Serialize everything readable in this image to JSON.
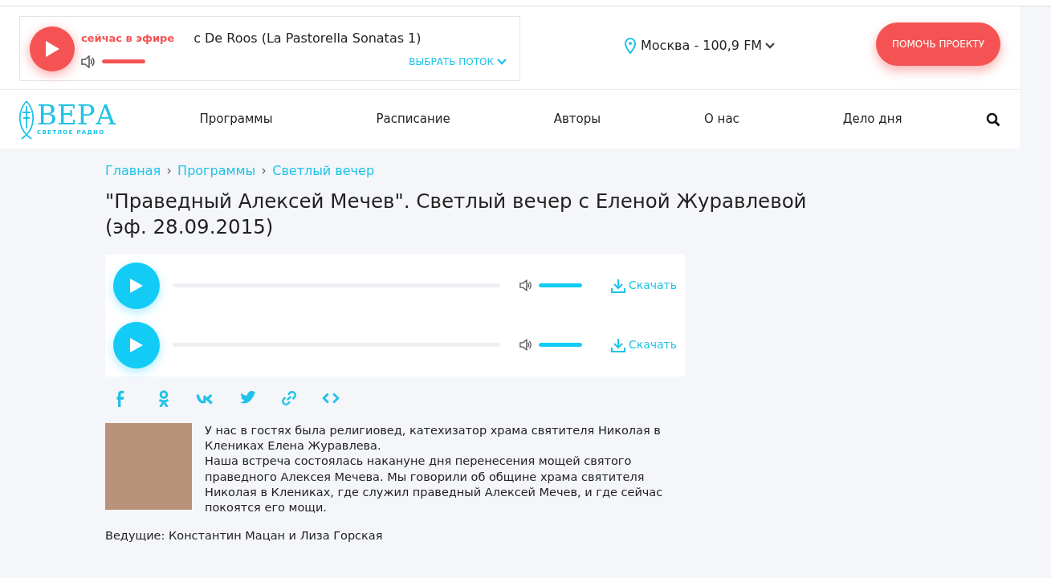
{
  "player": {
    "on_air": "сейчас в эфире",
    "track": "c De Roos (La Pastorella Sonatas 1)",
    "volume": {
      "level": 1
    },
    "stream_button": "ВЫБРАТЬ ПОТОК"
  },
  "station": "Москва - 100,9 FM",
  "donate_button": "ПОМОЧЬ ПРОЕКТУ",
  "logo": {
    "name": "ВЕРА",
    "tagline": "СВЕТЛОЕ РАДИО"
  },
  "nav": [
    "Программы",
    "Расписание",
    "Авторы",
    "О нас",
    "Дело дня"
  ],
  "breadcrumbs": [
    "Главная",
    "Программы",
    "Светлый вечер"
  ],
  "title": "\"Праведный Алексей Мечев\". Светлый вечер с Еленой Журавлевой (эф. 28.09.2015)",
  "audio": [
    {
      "progress": {
        "level": 0
      },
      "volume": {
        "level": 1
      },
      "download": "Скачать"
    },
    {
      "progress": {
        "level": 0
      },
      "volume": {
        "level": 1
      },
      "download": "Скачать"
    }
  ],
  "share": [
    {
      "kind": "facebook"
    },
    {
      "kind": "ok"
    },
    {
      "kind": "vk"
    },
    {
      "kind": "twitter"
    },
    {
      "kind": "link"
    },
    {
      "kind": "embed"
    }
  ],
  "description": [
    "У нас в гостях была религиовед, катехизатор храма святителя Николая в Клениках Елена Журавлева.",
    "Наша встреча состоялась накануне дня перенесения мощей святого праведного Алексея Мечева. Мы говорили об общине храма святителя Николая в Клениках, где служил праведный Алексей Мечев, и где сейчас покоятся его мощи."
  ],
  "hosts": "Ведущие: Константин Мацан и Лиза Горская"
}
